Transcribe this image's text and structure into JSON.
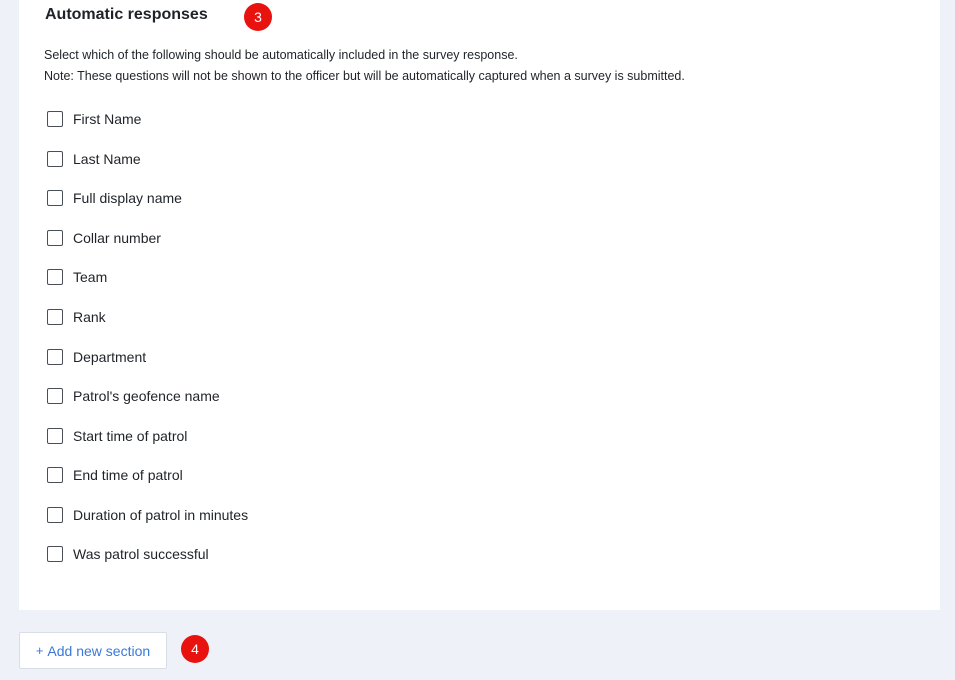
{
  "section": {
    "title": "Automatic responses",
    "step_badge": "3",
    "description_line1": "Select which of the following should be automatically included in the survey response.",
    "description_line2": "Note: These questions will not be shown to the officer but will be automatically captured when a survey is submitted.",
    "options": [
      {
        "label": "First Name",
        "checked": false
      },
      {
        "label": "Last Name",
        "checked": false
      },
      {
        "label": "Full display name",
        "checked": false
      },
      {
        "label": "Collar number",
        "checked": false
      },
      {
        "label": "Team",
        "checked": false
      },
      {
        "label": "Rank",
        "checked": false
      },
      {
        "label": "Department",
        "checked": false
      },
      {
        "label": "Patrol's geofence name",
        "checked": false
      },
      {
        "label": "Start time of patrol",
        "checked": false
      },
      {
        "label": "End time of patrol",
        "checked": false
      },
      {
        "label": "Duration of patrol in minutes",
        "checked": false
      },
      {
        "label": "Was patrol successful",
        "checked": false
      }
    ]
  },
  "footer": {
    "add_section_icon": "+",
    "add_section_label": "Add new section",
    "step_badge": "4"
  },
  "colors": {
    "page_background": "#eef1f8",
    "card_background": "#ffffff",
    "badge": "#e8130f",
    "link_blue": "#3a78d8"
  }
}
